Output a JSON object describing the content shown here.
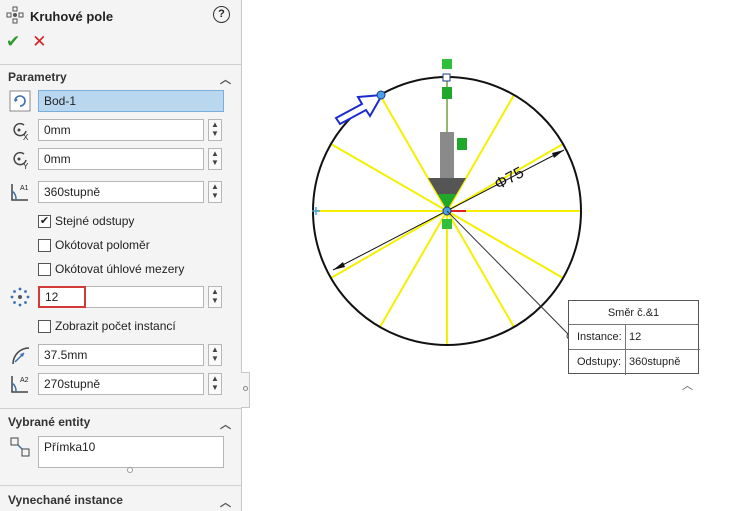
{
  "panel": {
    "title": "Kruhové pole",
    "help_label": "?",
    "parameters": {
      "title": "Parametry",
      "center_value": "Bod-1",
      "x_value": "0mm",
      "y_value": "0mm",
      "angle_value": "360stupně",
      "equal_spacing_label": "Stejné odstupy",
      "dim_radius_label": "Okótovat poloměr",
      "dim_angular_label": "Okótovat úhlové mezery",
      "count_value": "12",
      "show_count_label": "Zobrazit počet instancí",
      "radius_value": "37.5mm",
      "start_angle_value": "270stupně"
    },
    "selected_entities": {
      "title": "Vybrané entity",
      "items": [
        "Přímka10"
      ]
    },
    "skipped_instances": {
      "title": "Vynechané instance"
    }
  },
  "graphics": {
    "diameter_label": "Φ75"
  },
  "callout": {
    "title": "Směr č.&1",
    "instances_label": "Instance:",
    "instances_value": "12",
    "spacing_label": "Odstupy:",
    "spacing_value": "360stupně"
  }
}
